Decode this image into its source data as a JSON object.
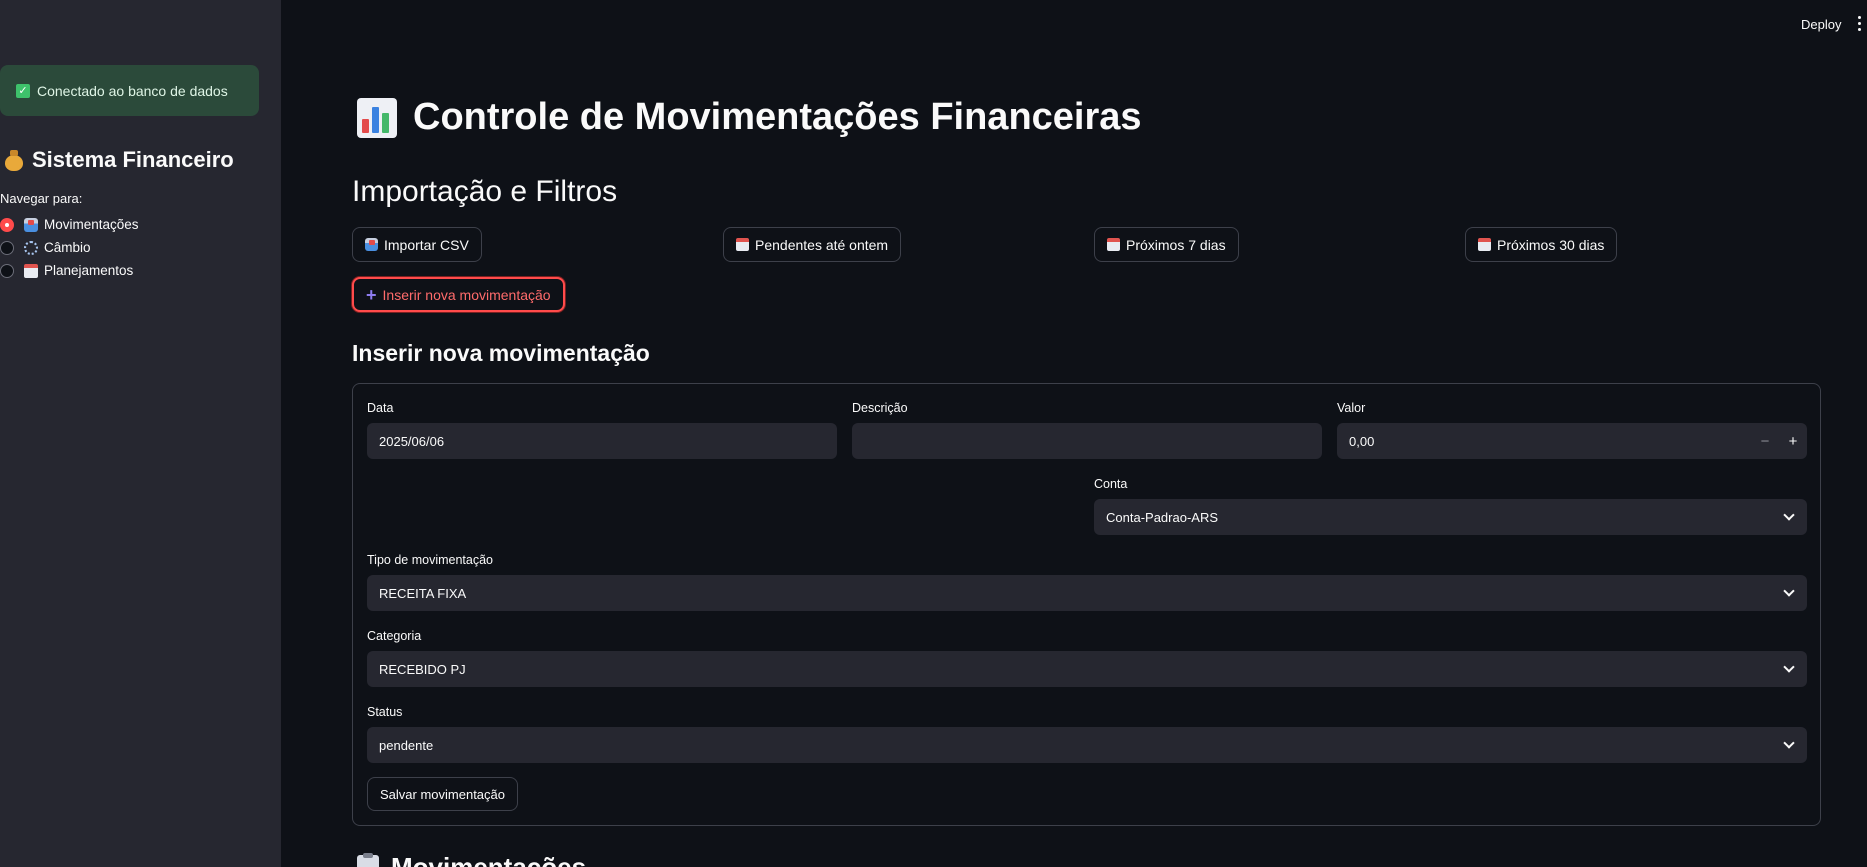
{
  "header": {
    "deploy_label": "Deploy"
  },
  "sidebar": {
    "db_status": "Conectado ao banco de dados",
    "title": "Sistema Financeiro",
    "nav_label": "Navegar para:",
    "items": [
      {
        "label": "Movimentações",
        "icon": "inbox-tray-icon",
        "selected": true
      },
      {
        "label": "Câmbio",
        "icon": "exchange-icon",
        "selected": false
      },
      {
        "label": "Planejamentos",
        "icon": "calendar-icon",
        "selected": false
      }
    ]
  },
  "main": {
    "title": "Controle de Movimentações Financeiras",
    "import_section": "Importação e Filtros",
    "buttons": {
      "import_csv": "Importar CSV",
      "pending_yesterday": "Pendentes até ontem",
      "next_7": "Próximos 7 dias",
      "next_30": "Próximos 30 dias",
      "insert_new": "Inserir nova movimentação"
    },
    "insert_section": "Inserir nova movimentação",
    "form": {
      "date_label": "Data",
      "date_value": "2025/06/06",
      "description_label": "Descrição",
      "description_value": "",
      "value_label": "Valor",
      "value_value": "0,00",
      "minus": "−",
      "plus": "+",
      "account_label": "Conta",
      "account_value": "Conta-Padrao-ARS",
      "type_label": "Tipo de movimentação",
      "type_value": "RECEITA FIXA",
      "category_label": "Categoria",
      "category_value": "RECEBIDO PJ",
      "status_label": "Status",
      "status_value": "pendente",
      "save_label": "Salvar movimentação"
    },
    "next_section": "Movimentações"
  },
  "colors": {
    "accent": "#ff4b4b",
    "background": "#0e1117",
    "sidebar": "#262730",
    "success": "#2b4a3a"
  }
}
